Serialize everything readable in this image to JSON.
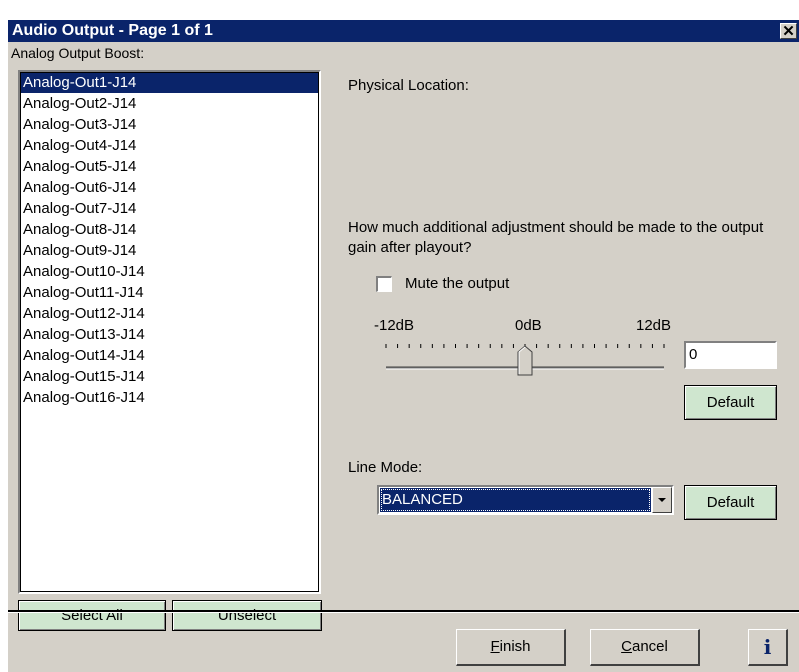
{
  "window": {
    "title": "Audio Output - Page 1 of 1",
    "close_icon": "close-icon",
    "close_glyph": "✕"
  },
  "output_list": {
    "label": "Analog Output Boost:",
    "items": [
      "Analog-Out1-J14",
      "Analog-Out2-J14",
      "Analog-Out3-J14",
      "Analog-Out4-J14",
      "Analog-Out5-J14",
      "Analog-Out6-J14",
      "Analog-Out7-J14",
      "Analog-Out8-J14",
      "Analog-Out9-J14",
      "Analog-Out10-J14",
      "Analog-Out11-J14",
      "Analog-Out12-J14",
      "Analog-Out13-J14",
      "Analog-Out14-J14",
      "Analog-Out15-J14",
      "Analog-Out16-J14"
    ],
    "selected_index": 0,
    "select_all_label": "Select All",
    "unselect_label": "Unselect"
  },
  "details": {
    "physical_location_label": "Physical Location:",
    "gain_question": "How much additional adjustment should be made to the output gain after playout?",
    "mute_label": "Mute the output",
    "mute_checked": false,
    "slider": {
      "min_label": "-12dB",
      "mid_label": "0dB",
      "max_label": "12dB",
      "min": -12,
      "max": 12,
      "value": 0
    },
    "gain_value": "0",
    "gain_default_label": "Default",
    "line_mode_label": "Line Mode:",
    "line_mode_value": "BALANCED",
    "line_mode_default_label": "Default"
  },
  "footer": {
    "finish_label": "Finish",
    "cancel_label": "Cancel",
    "info_label": "i"
  },
  "colors": {
    "titlebar": "#0a246a",
    "dialog_bg": "#d4d0c8",
    "selection": "#0a246a",
    "green_button": "#cfe6cf"
  }
}
